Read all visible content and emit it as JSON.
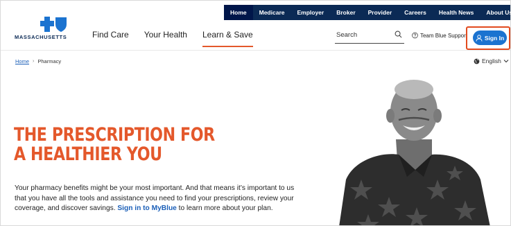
{
  "topnav": {
    "items": [
      "Home",
      "Medicare",
      "Employer",
      "Broker",
      "Provider",
      "Careers",
      "Health News",
      "About Us"
    ]
  },
  "logo": {
    "wordmark": "MASSACHUSETTS"
  },
  "mainnav": {
    "items": [
      "Find Care",
      "Your Health",
      "Learn & Save"
    ],
    "current": "Learn & Save"
  },
  "search": {
    "label": "Search"
  },
  "support": {
    "label": "Team Blue Support"
  },
  "signin": {
    "label": "Sign In"
  },
  "breadcrumb": {
    "home": "Home",
    "separator": "›",
    "current": "Pharmacy"
  },
  "language": {
    "label": "English"
  },
  "hero": {
    "title_line1": "THE PRESCRIPTION FOR",
    "title_line2": "A HEALTHIER YOU",
    "body_pre": "Your pharmacy benefits might be your most important. And that means it’s important to us that you have all the tools and assistance you need to find your prescriptions, review your coverage, and discover savings. ",
    "body_link": "Sign in to MyBlue",
    "body_post": " to learn more about your plan."
  },
  "colors": {
    "navy": "#0b2a55",
    "accent_orange": "#e4582b",
    "link_blue": "#1b5fb8",
    "signin_blue": "#1b73d0"
  }
}
